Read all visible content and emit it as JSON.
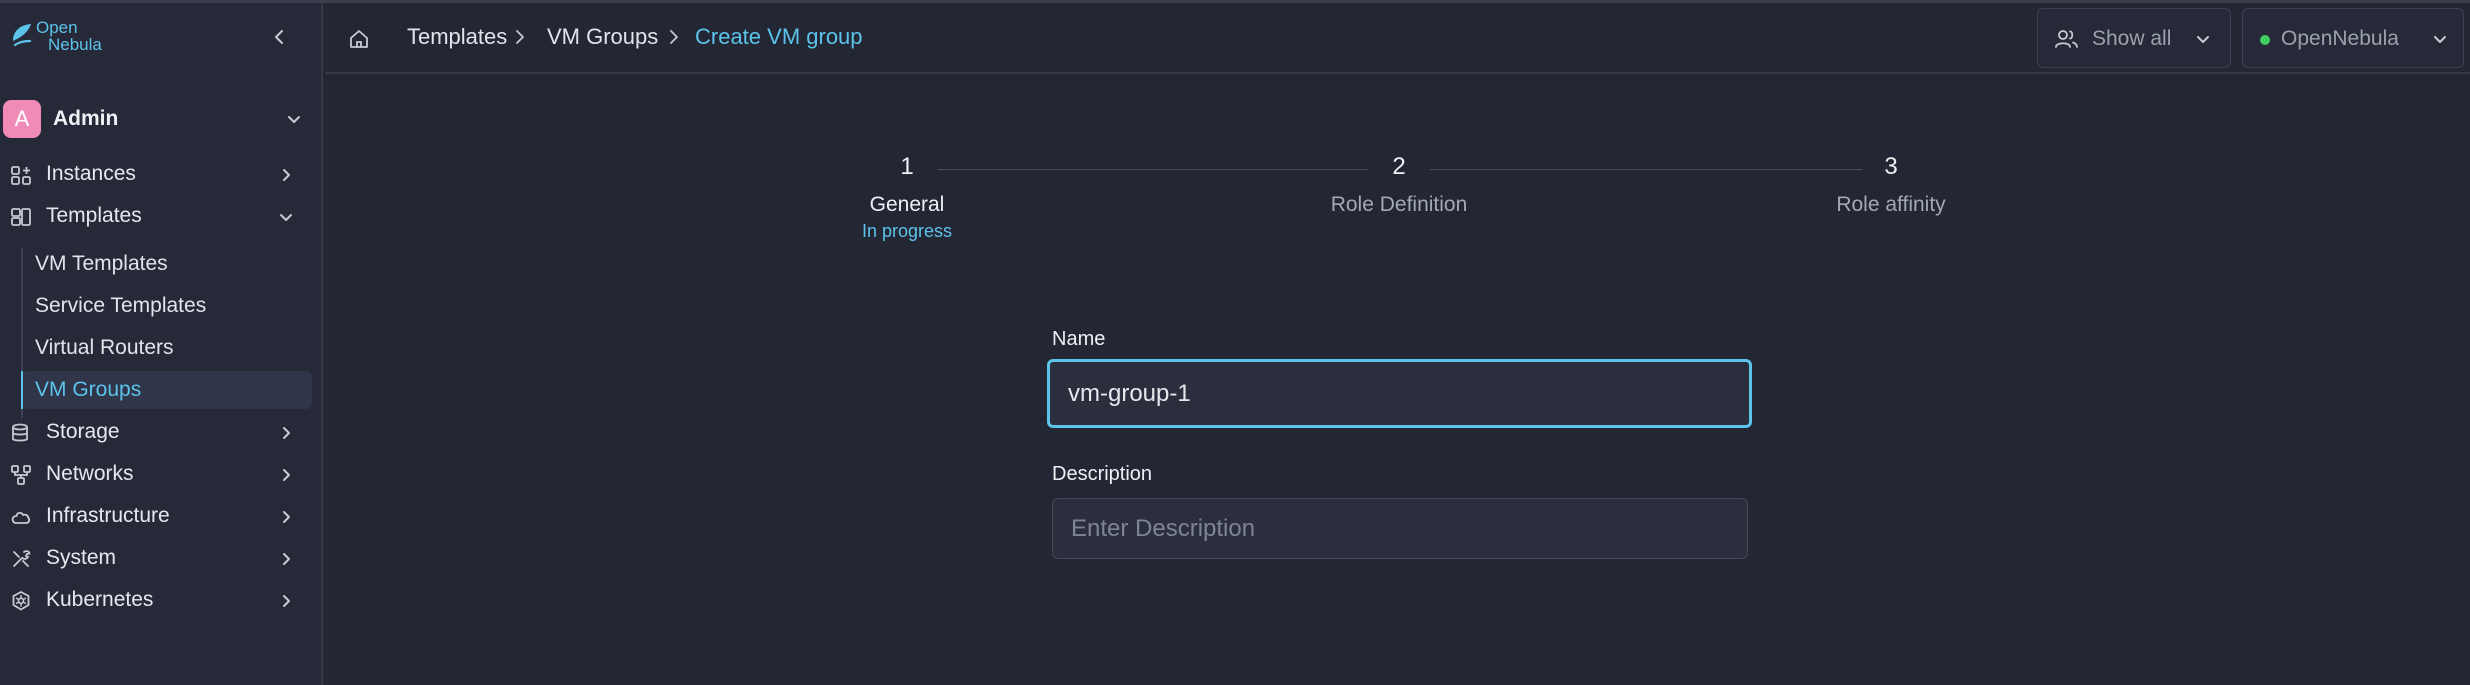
{
  "app": {
    "logo_text": [
      "Open",
      "Nebula"
    ]
  },
  "sidebar": {
    "user": {
      "avatar_letter": "A",
      "name": "Admin"
    },
    "items": [
      {
        "label": "Instances",
        "icon": "instances-icon",
        "expanded": false
      },
      {
        "label": "Templates",
        "icon": "templates-icon",
        "expanded": true
      },
      {
        "label": "Storage",
        "icon": "storage-icon",
        "expanded": false
      },
      {
        "label": "Networks",
        "icon": "networks-icon",
        "expanded": false
      },
      {
        "label": "Infrastructure",
        "icon": "cloud-icon",
        "expanded": false
      },
      {
        "label": "System",
        "icon": "system-tools-icon",
        "expanded": false
      },
      {
        "label": "Kubernetes",
        "icon": "kubernetes-icon",
        "expanded": false
      }
    ],
    "template_subitems": [
      {
        "label": "VM Templates",
        "active": false
      },
      {
        "label": "Service Templates",
        "active": false
      },
      {
        "label": "Virtual Routers",
        "active": false
      },
      {
        "label": "VM Groups",
        "active": true
      }
    ]
  },
  "header": {
    "breadcrumb": [
      "Templates",
      "VM Groups",
      "Create VM group"
    ],
    "filter_label": "Show all",
    "zone_label": "OpenNebula",
    "zone_status_color": "#3ecf5e"
  },
  "stepper": {
    "steps": [
      {
        "number": "1",
        "label": "General",
        "status": "In progress",
        "active": true
      },
      {
        "number": "2",
        "label": "Role Definition",
        "status": "",
        "active": false
      },
      {
        "number": "3",
        "label": "Role affinity",
        "status": "",
        "active": false
      }
    ]
  },
  "form": {
    "name_label": "Name",
    "name_value": "vm-group-1",
    "description_label": "Description",
    "description_placeholder": "Enter Description",
    "description_value": ""
  },
  "colors": {
    "accent": "#5cc3ea",
    "background": "#232633",
    "sidebar": "#262a38",
    "avatar": "#f08bb8"
  }
}
